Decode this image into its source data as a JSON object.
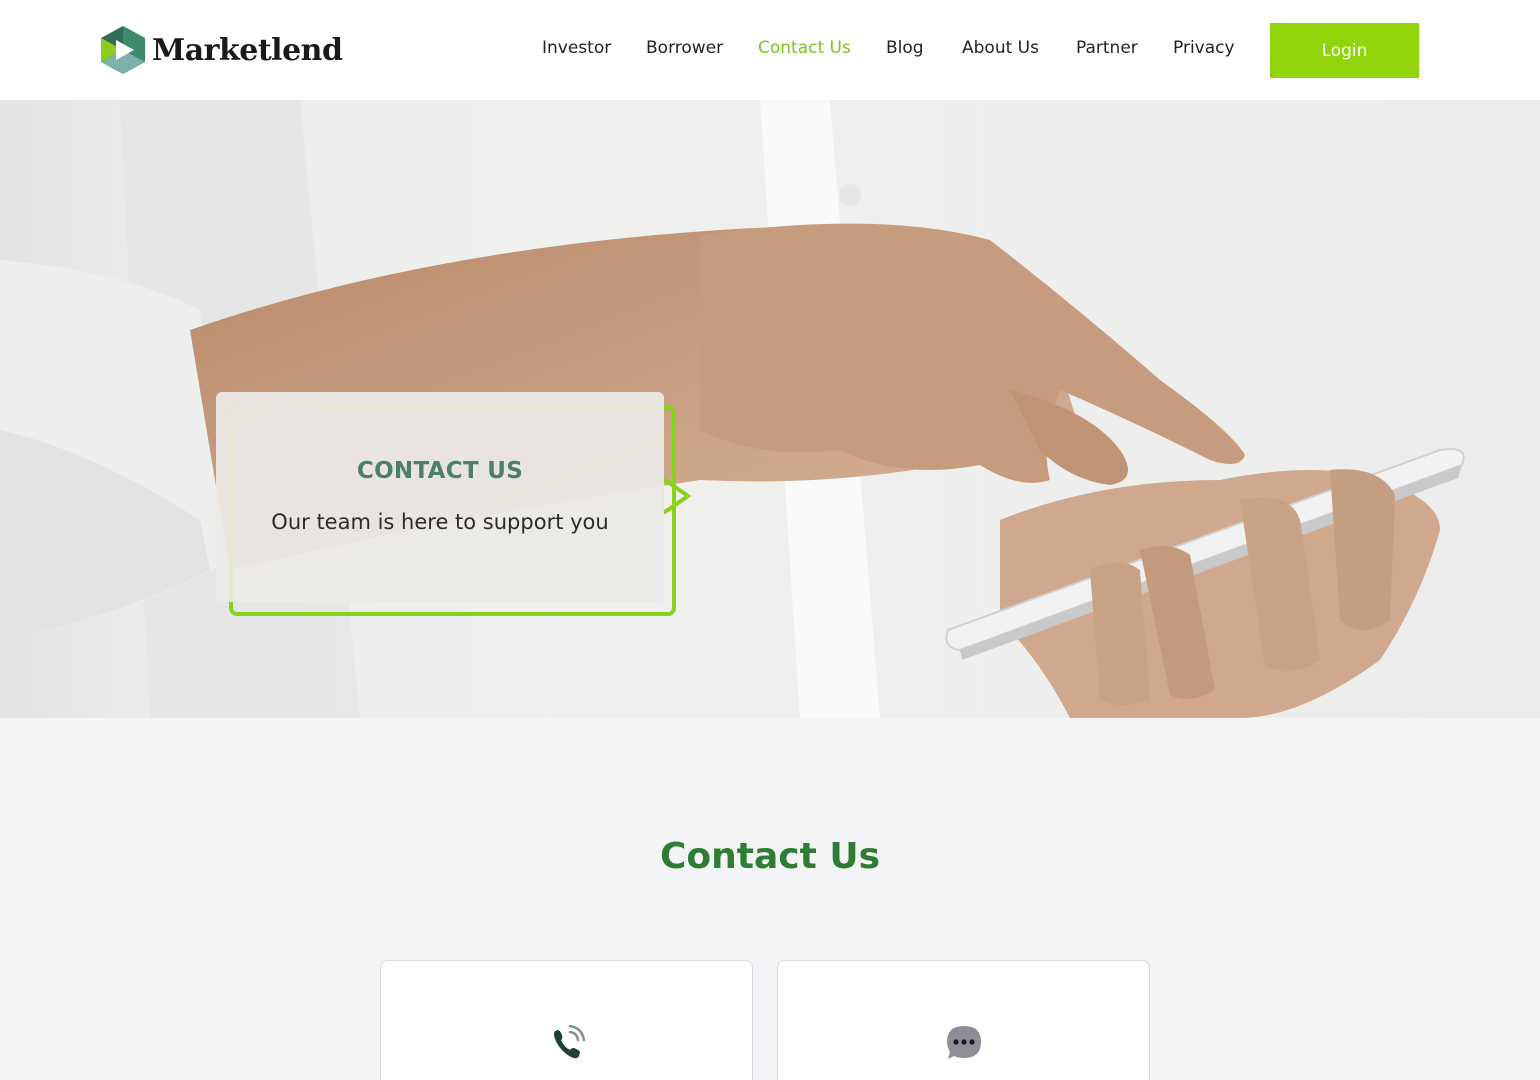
{
  "brand": {
    "name": "Marketlend"
  },
  "nav": {
    "items": [
      {
        "label": "Investor",
        "active": false
      },
      {
        "label": "Borrower",
        "active": false
      },
      {
        "label": "Contact Us",
        "active": true
      },
      {
        "label": "Blog",
        "active": false
      },
      {
        "label": "About Us",
        "active": false
      },
      {
        "label": "Partner",
        "active": false
      },
      {
        "label": "Privacy",
        "active": false
      }
    ],
    "login_label": "Login"
  },
  "hero": {
    "title": "CONTACT US",
    "subtitle": "Our team is here to support you",
    "image": "hand-tapping-smartphone"
  },
  "contact_section": {
    "title": "Contact Us",
    "cards": [
      {
        "icon": "phone-icon"
      },
      {
        "icon": "chat-bubble-icon"
      }
    ]
  },
  "colors": {
    "accent_green": "#91d409",
    "active_nav": "#7cc41f",
    "section_title": "#2e7d32",
    "hero_title": "#4b7f6c",
    "logo_dark": "#2f6f57",
    "logo_light": "#7fb0ac",
    "logo_lime": "#8ccc1f"
  }
}
